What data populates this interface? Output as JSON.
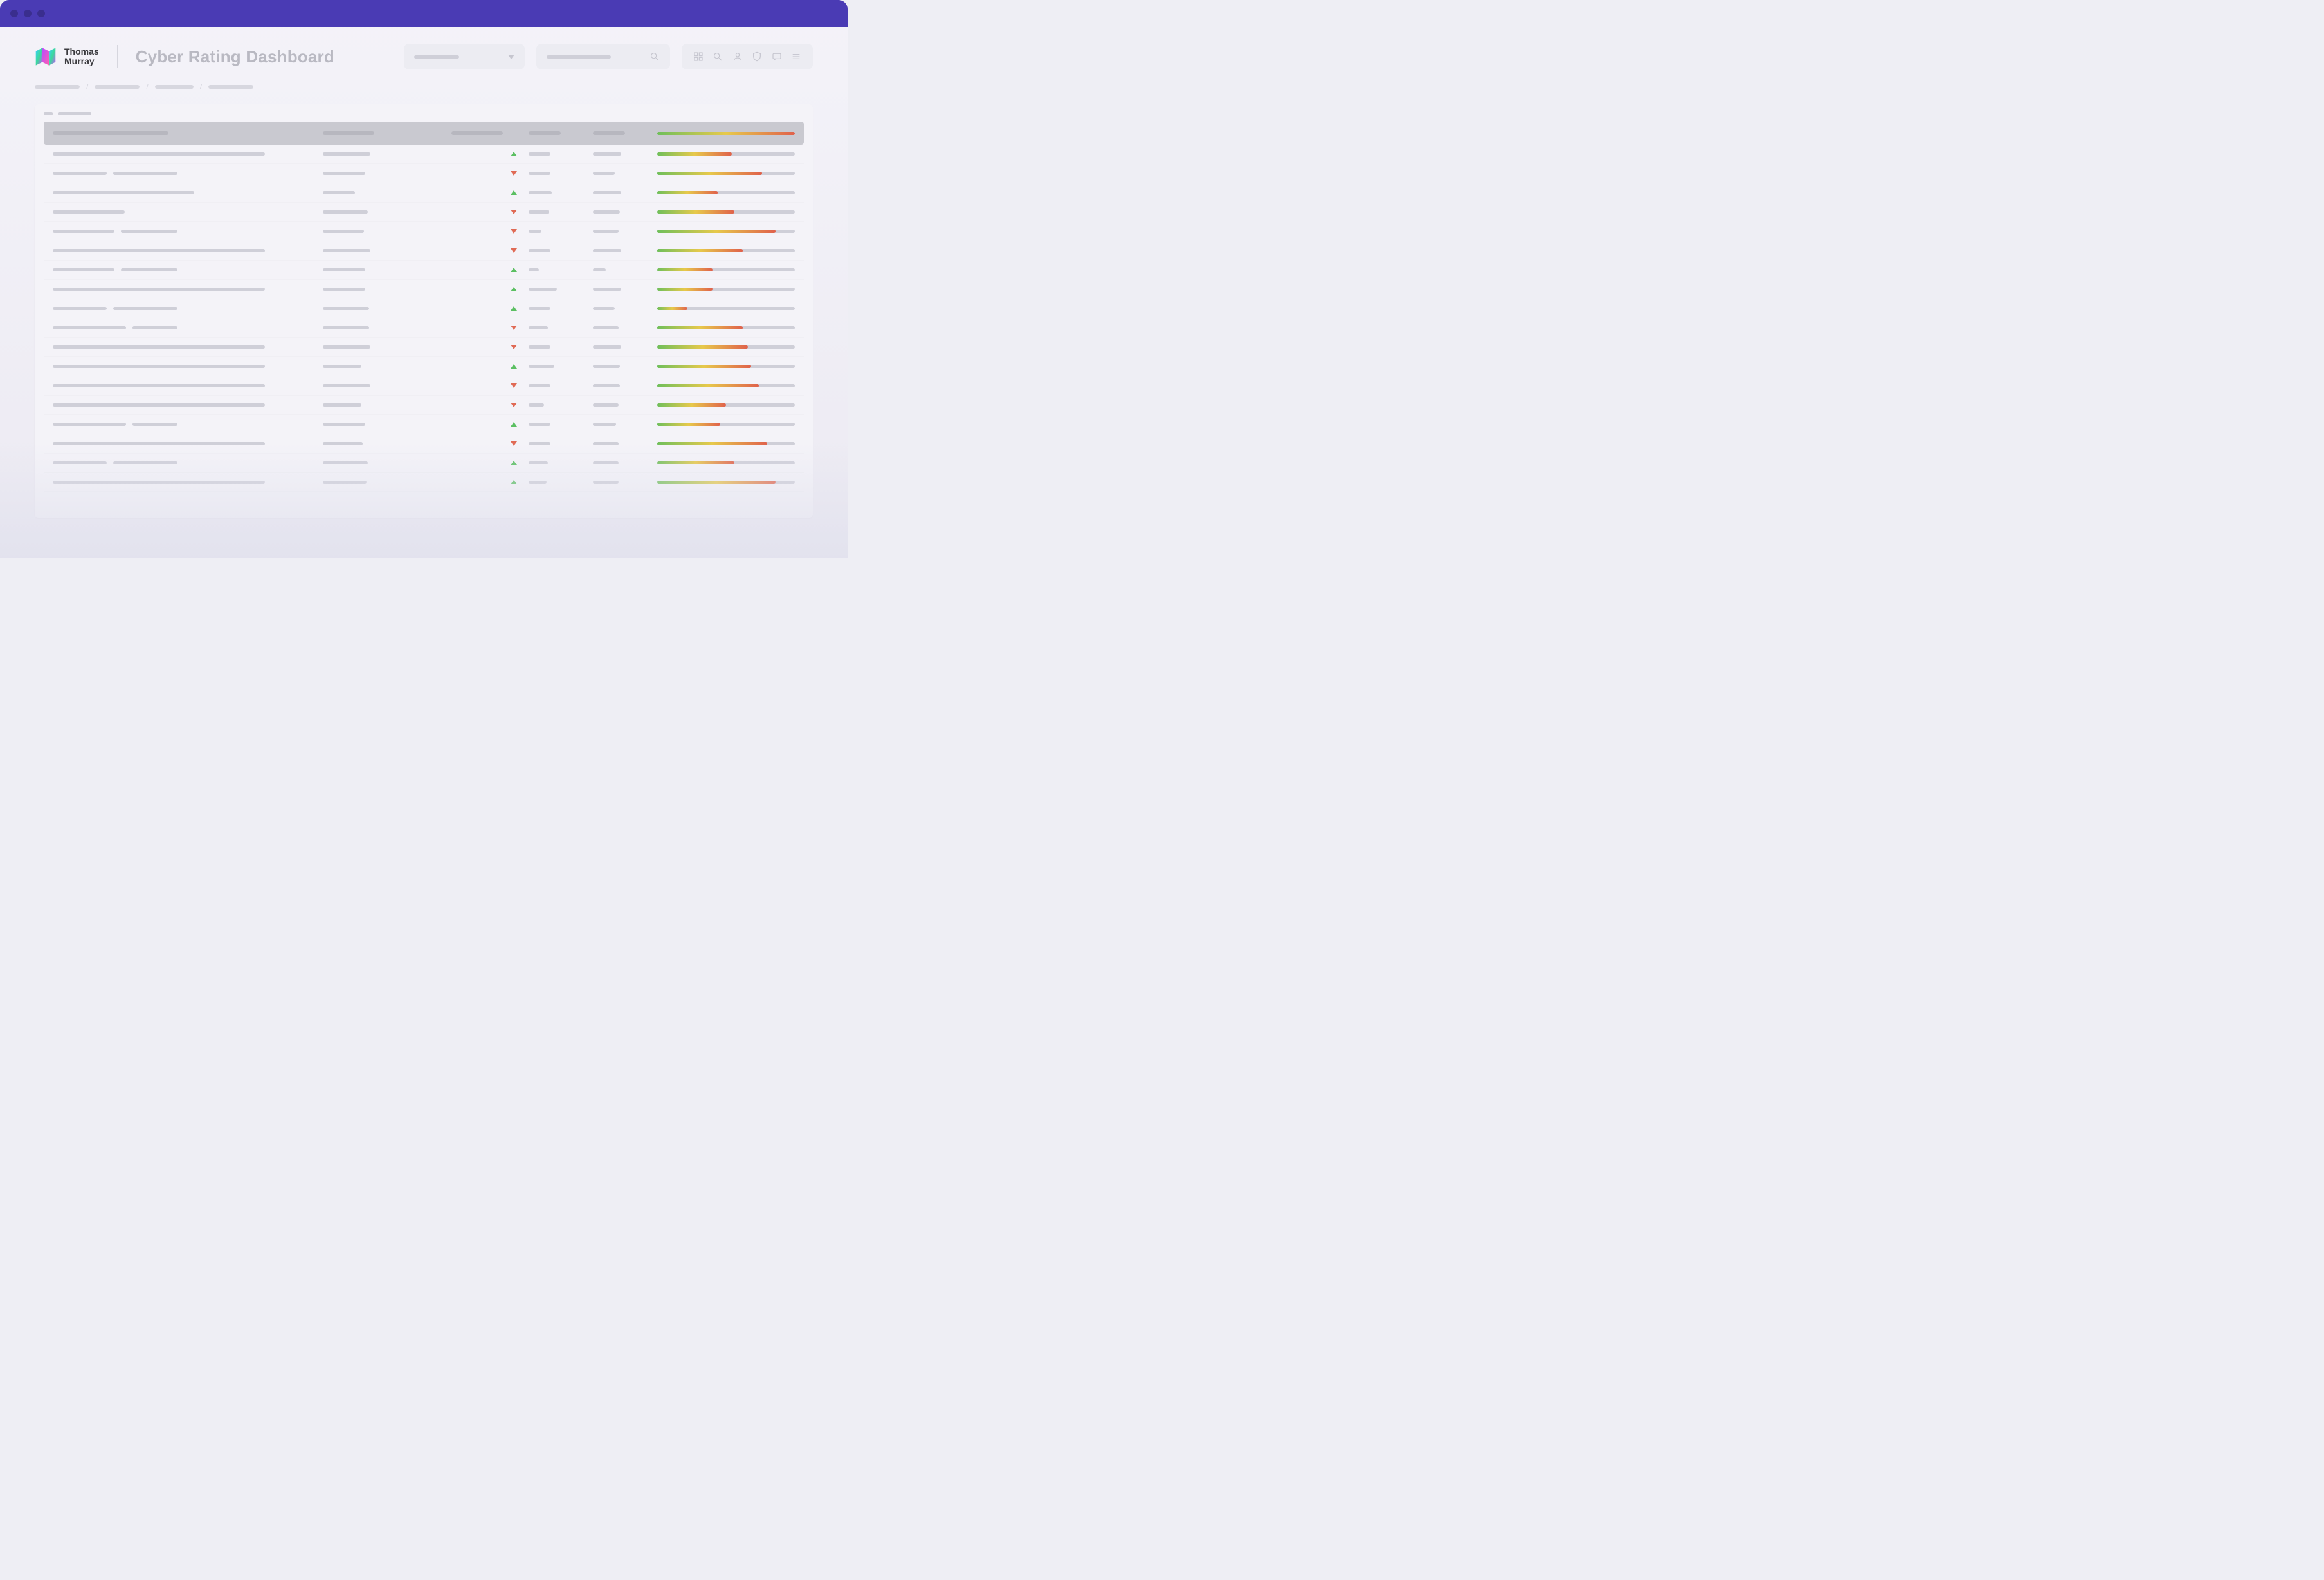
{
  "brand": {
    "line1": "Thomas",
    "line2": "Murray"
  },
  "page_title": "Cyber Rating Dashboard",
  "colors": {
    "titlebar": "#4a3bb4",
    "green": "#5bbf62",
    "red": "#e06a55"
  },
  "header_controls": {
    "dropdown_placeholder_width": 70,
    "search_placeholder_width": 100,
    "iconbar": [
      "grid-icon",
      "search-icon",
      "user-icon",
      "shield-icon",
      "chat-icon",
      "menu-icon"
    ]
  },
  "breadcrumbs": [
    70,
    70,
    60,
    70
  ],
  "table": {
    "header_placeholders": {
      "name_w": 180,
      "col2_w": 80,
      "col3_w": 80,
      "col4_w": 50,
      "col5_w": 50
    },
    "rows": [
      {
        "name_w": 330,
        "sub_w": 0,
        "col2_w": 74,
        "trend": "up",
        "c4_w": 34,
        "c5_w": 44,
        "spark_pct": 54
      },
      {
        "name_w": 84,
        "sub_w": 100,
        "col2_w": 66,
        "trend": "down",
        "c4_w": 34,
        "c5_w": 34,
        "spark_pct": 76
      },
      {
        "name_w": 220,
        "sub_w": 0,
        "col2_w": 50,
        "trend": "up",
        "c4_w": 36,
        "c5_w": 44,
        "spark_pct": 44
      },
      {
        "name_w": 112,
        "sub_w": 0,
        "col2_w": 70,
        "trend": "down",
        "c4_w": 32,
        "c5_w": 42,
        "spark_pct": 56
      },
      {
        "name_w": 96,
        "sub_w": 88,
        "col2_w": 64,
        "trend": "down",
        "c4_w": 20,
        "c5_w": 40,
        "spark_pct": 86
      },
      {
        "name_w": 330,
        "sub_w": 0,
        "col2_w": 74,
        "trend": "down",
        "c4_w": 34,
        "c5_w": 44,
        "spark_pct": 62
      },
      {
        "name_w": 96,
        "sub_w": 88,
        "col2_w": 66,
        "trend": "up",
        "c4_w": 16,
        "c5_w": 20,
        "spark_pct": 40
      },
      {
        "name_w": 330,
        "sub_w": 0,
        "col2_w": 66,
        "trend": "up",
        "c4_w": 44,
        "c5_w": 44,
        "spark_pct": 40
      },
      {
        "name_w": 84,
        "sub_w": 100,
        "col2_w": 72,
        "trend": "up",
        "c4_w": 34,
        "c5_w": 34,
        "spark_pct": 22
      },
      {
        "name_w": 114,
        "sub_w": 70,
        "col2_w": 72,
        "trend": "down",
        "c4_w": 30,
        "c5_w": 40,
        "spark_pct": 62
      },
      {
        "name_w": 330,
        "sub_w": 0,
        "col2_w": 74,
        "trend": "down",
        "c4_w": 34,
        "c5_w": 44,
        "spark_pct": 66
      },
      {
        "name_w": 330,
        "sub_w": 0,
        "col2_w": 60,
        "trend": "up",
        "c4_w": 40,
        "c5_w": 42,
        "spark_pct": 68
      },
      {
        "name_w": 330,
        "sub_w": 0,
        "col2_w": 74,
        "trend": "down",
        "c4_w": 34,
        "c5_w": 42,
        "spark_pct": 74
      },
      {
        "name_w": 330,
        "sub_w": 0,
        "col2_w": 60,
        "trend": "down",
        "c4_w": 24,
        "c5_w": 40,
        "spark_pct": 50
      },
      {
        "name_w": 114,
        "sub_w": 70,
        "col2_w": 66,
        "trend": "up",
        "c4_w": 34,
        "c5_w": 36,
        "spark_pct": 46
      },
      {
        "name_w": 330,
        "sub_w": 0,
        "col2_w": 62,
        "trend": "down",
        "c4_w": 34,
        "c5_w": 40,
        "spark_pct": 80
      },
      {
        "name_w": 84,
        "sub_w": 100,
        "col2_w": 70,
        "trend": "up",
        "c4_w": 30,
        "c5_w": 40,
        "spark_pct": 56
      },
      {
        "name_w": 330,
        "sub_w": 0,
        "col2_w": 68,
        "trend": "up",
        "c4_w": 28,
        "c5_w": 40,
        "spark_pct": 86
      }
    ]
  }
}
